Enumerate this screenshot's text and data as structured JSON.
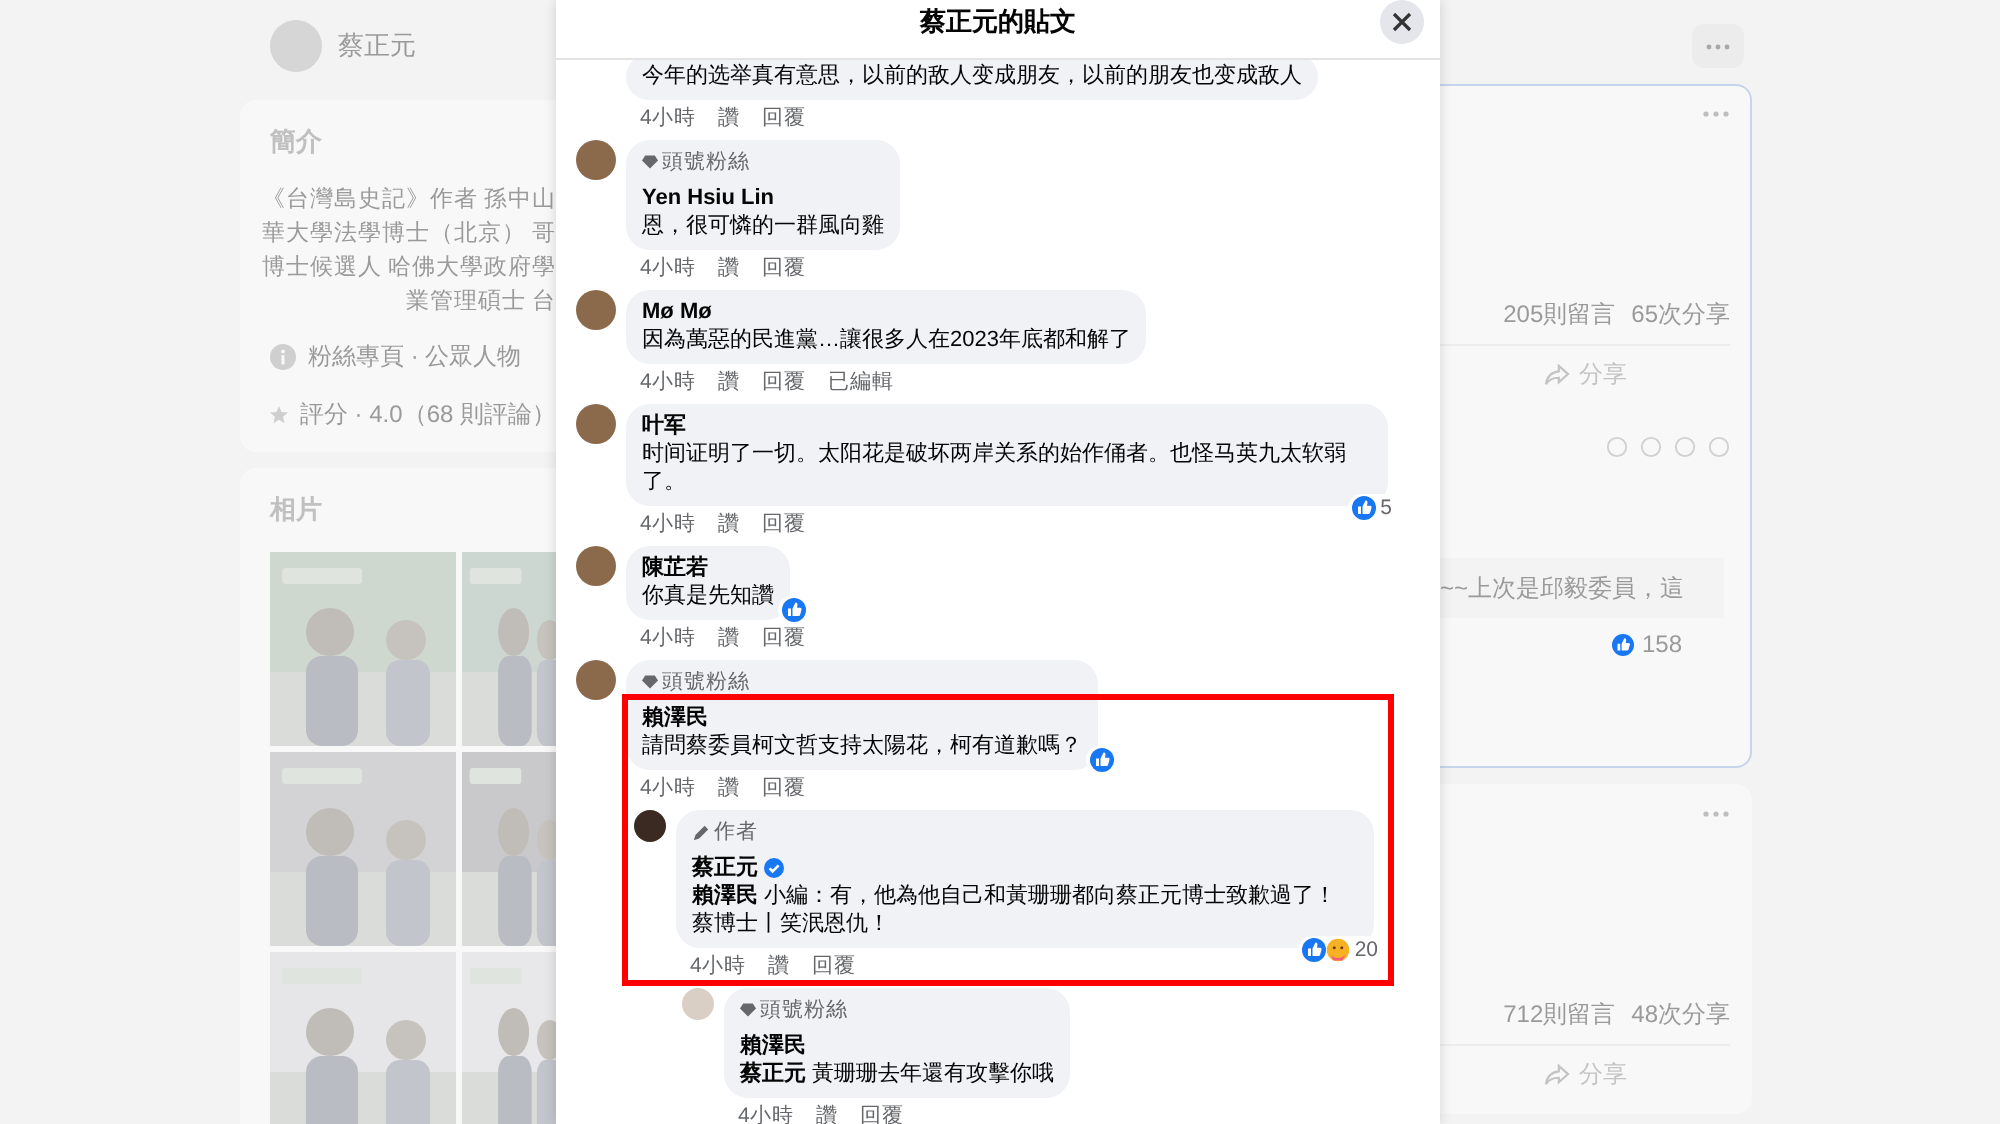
{
  "background": {
    "profile": {
      "name": "蔡正元"
    },
    "intro": {
      "title": "簡介",
      "lines": [
        "《台灣島史記》作者 孫中山",
        "華大學法學博士（北京） 哥",
        "博士候選人 哈佛大學政府學",
        "業管理碩士 台"
      ]
    },
    "facts": [
      {
        "kind": "info",
        "text": "粉絲專頁 · 公眾人物"
      },
      {
        "kind": "rating",
        "text": "評分 · 4.0（68 則評論）"
      }
    ],
    "photos": {
      "title": "相片"
    },
    "posts": [
      {
        "selected": true,
        "comments": "205則留言",
        "shares": "65次分享",
        "share": "分享",
        "comment_preview": "~~上次是邱毅委員，這",
        "reaction_count": "158"
      },
      {
        "selected": false,
        "comments": "712則留言",
        "shares": "48次分享",
        "share": "分享"
      }
    ]
  },
  "modal": {
    "title": "蔡正元的貼文",
    "comments": [
      {
        "text": "今年的选举真有意思，以前的敌人变成朋友，以前的朋友也变成敌人",
        "time": "4小時",
        "actions": [
          "讚",
          "回覆"
        ]
      },
      {
        "badge": {
          "kind": "top_fan",
          "text": "頭號粉絲"
        },
        "name": "Yen Hsiu Lin",
        "text": "恩，很可憐的一群風向雞",
        "time": "4小時",
        "actions": [
          "讚",
          "回覆"
        ]
      },
      {
        "name": "Mø Mø",
        "text": "因為萬惡的民進黨…讓很多人在2023年底都和解了",
        "time": "4小時",
        "actions": [
          "讚",
          "回覆"
        ],
        "edited": "已編輯"
      },
      {
        "name": "叶军",
        "text": "时间证明了一切。太阳花是破坏两岸关系的始作俑者。也怪马英九太软弱了。",
        "reactions": {
          "icons": [
            {
              "kind": "like"
            }
          ],
          "count": "5"
        },
        "time": "4小時",
        "actions": [
          "讚",
          "回覆"
        ]
      },
      {
        "name": "陳芷若",
        "text": "你真是先知讚",
        "reactions": {
          "icons": [
            {
              "kind": "like"
            }
          ]
        },
        "time": "4小時",
        "actions": [
          "讚",
          "回覆"
        ]
      },
      {
        "highlighted": true,
        "badge": {
          "kind": "top_fan",
          "text": "頭號粉絲"
        },
        "name": "賴澤民",
        "text": "請問蔡委員柯文哲支持太陽花，柯有道歉嗎？",
        "reactions": {
          "icons": [
            {
              "kind": "like"
            }
          ]
        },
        "time": "4小時",
        "actions": [
          "讚",
          "回覆"
        ],
        "replies": [
          {
            "badge": {
              "kind": "author",
              "text": "作者"
            },
            "name": "蔡正元",
            "verified": true,
            "text": "**賴澤民** 小編：有，他為他自己和黃珊珊都向蔡正元博士致歉過了！蔡博士丨笑泯恩仇！",
            "reactions": {
              "icons": [
                {
                  "kind": "like"
                },
                {
                  "kind": "care"
                }
              ],
              "count": "20"
            },
            "time": "4小時",
            "actions": [
              "讚",
              "回覆"
            ],
            "replies": [
              {
                "badge": {
                  "kind": "top_fan",
                  "text": "頭號粉絲"
                },
                "name": "賴澤民",
                "text": "**蔡正元** 黃珊珊去年還有攻擊你哦",
                "time": "4小時",
                "actions": [
                  "讚",
                  "回覆"
                ]
              }
            ]
          }
        ]
      }
    ]
  }
}
